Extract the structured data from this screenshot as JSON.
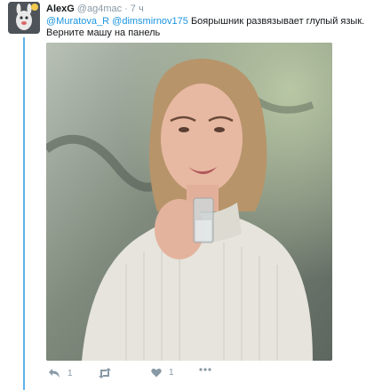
{
  "tweet": {
    "author_name": "AlexG",
    "handle": "@ag4mac",
    "separator": "·",
    "time": "7 ч",
    "mention1": "@Muratova_R",
    "mention2": "@dimsmirnov175",
    "text_line1": " Боярышник развязывает глупый язык.",
    "text_line2": "Верните машу на панель",
    "media_alt": "woman holding a small glass",
    "actions": {
      "reply_count": "1",
      "like_count": "1"
    }
  },
  "colors": {
    "mention": "#1b95e0",
    "thread_line": "#5fb4e8",
    "meta": "#8899a6"
  }
}
